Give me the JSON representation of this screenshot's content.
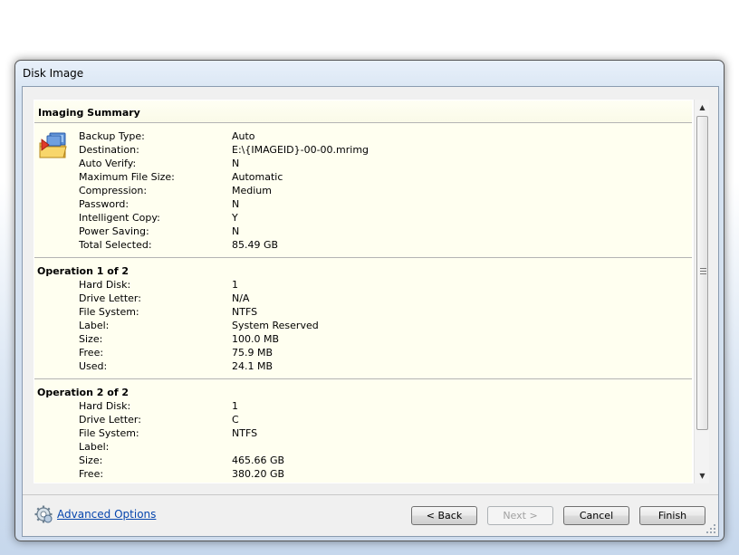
{
  "window": {
    "title": "Disk Image"
  },
  "summary": {
    "header": "Imaging Summary",
    "rows": [
      {
        "key": "Backup Type:",
        "value": "Auto"
      },
      {
        "key": "Destination:",
        "value": "E:\\{IMAGEID}-00-00.mrimg"
      },
      {
        "key": "Auto Verify:",
        "value": "N"
      },
      {
        "key": "Maximum File Size:",
        "value": "Automatic"
      },
      {
        "key": "Compression:",
        "value": "Medium"
      },
      {
        "key": "Password:",
        "value": "N"
      },
      {
        "key": "Intelligent Copy:",
        "value": "Y"
      },
      {
        "key": "Power Saving:",
        "value": "N"
      },
      {
        "key": "Total Selected:",
        "value": "85.49 GB"
      }
    ]
  },
  "operations": [
    {
      "title": "Operation 1 of 2",
      "rows": [
        {
          "key": "Hard Disk:",
          "value": "1"
        },
        {
          "key": "Drive Letter:",
          "value": "N/A"
        },
        {
          "key": "File System:",
          "value": "NTFS"
        },
        {
          "key": "Label:",
          "value": "System Reserved"
        },
        {
          "key": "Size:",
          "value": "100.0 MB"
        },
        {
          "key": "Free:",
          "value": "75.9 MB"
        },
        {
          "key": "Used:",
          "value": "24.1 MB"
        }
      ]
    },
    {
      "title": "Operation 2 of 2",
      "rows": [
        {
          "key": "Hard Disk:",
          "value": "1"
        },
        {
          "key": "Drive Letter:",
          "value": "C"
        },
        {
          "key": "File System:",
          "value": "NTFS"
        },
        {
          "key": "Label:",
          "value": ""
        },
        {
          "key": "Size:",
          "value": "465.66 GB"
        },
        {
          "key": "Free:",
          "value": "380.20 GB"
        }
      ]
    }
  ],
  "footer": {
    "advanced_options": "Advanced Options",
    "back": "< Back",
    "next": "Next >",
    "cancel": "Cancel",
    "finish": "Finish"
  },
  "icons": {
    "summary_icon": "disk-image-icon",
    "advanced_icon": "gear-icon",
    "scroll_up": "chevron-up-icon",
    "scroll_down": "chevron-down-icon"
  }
}
